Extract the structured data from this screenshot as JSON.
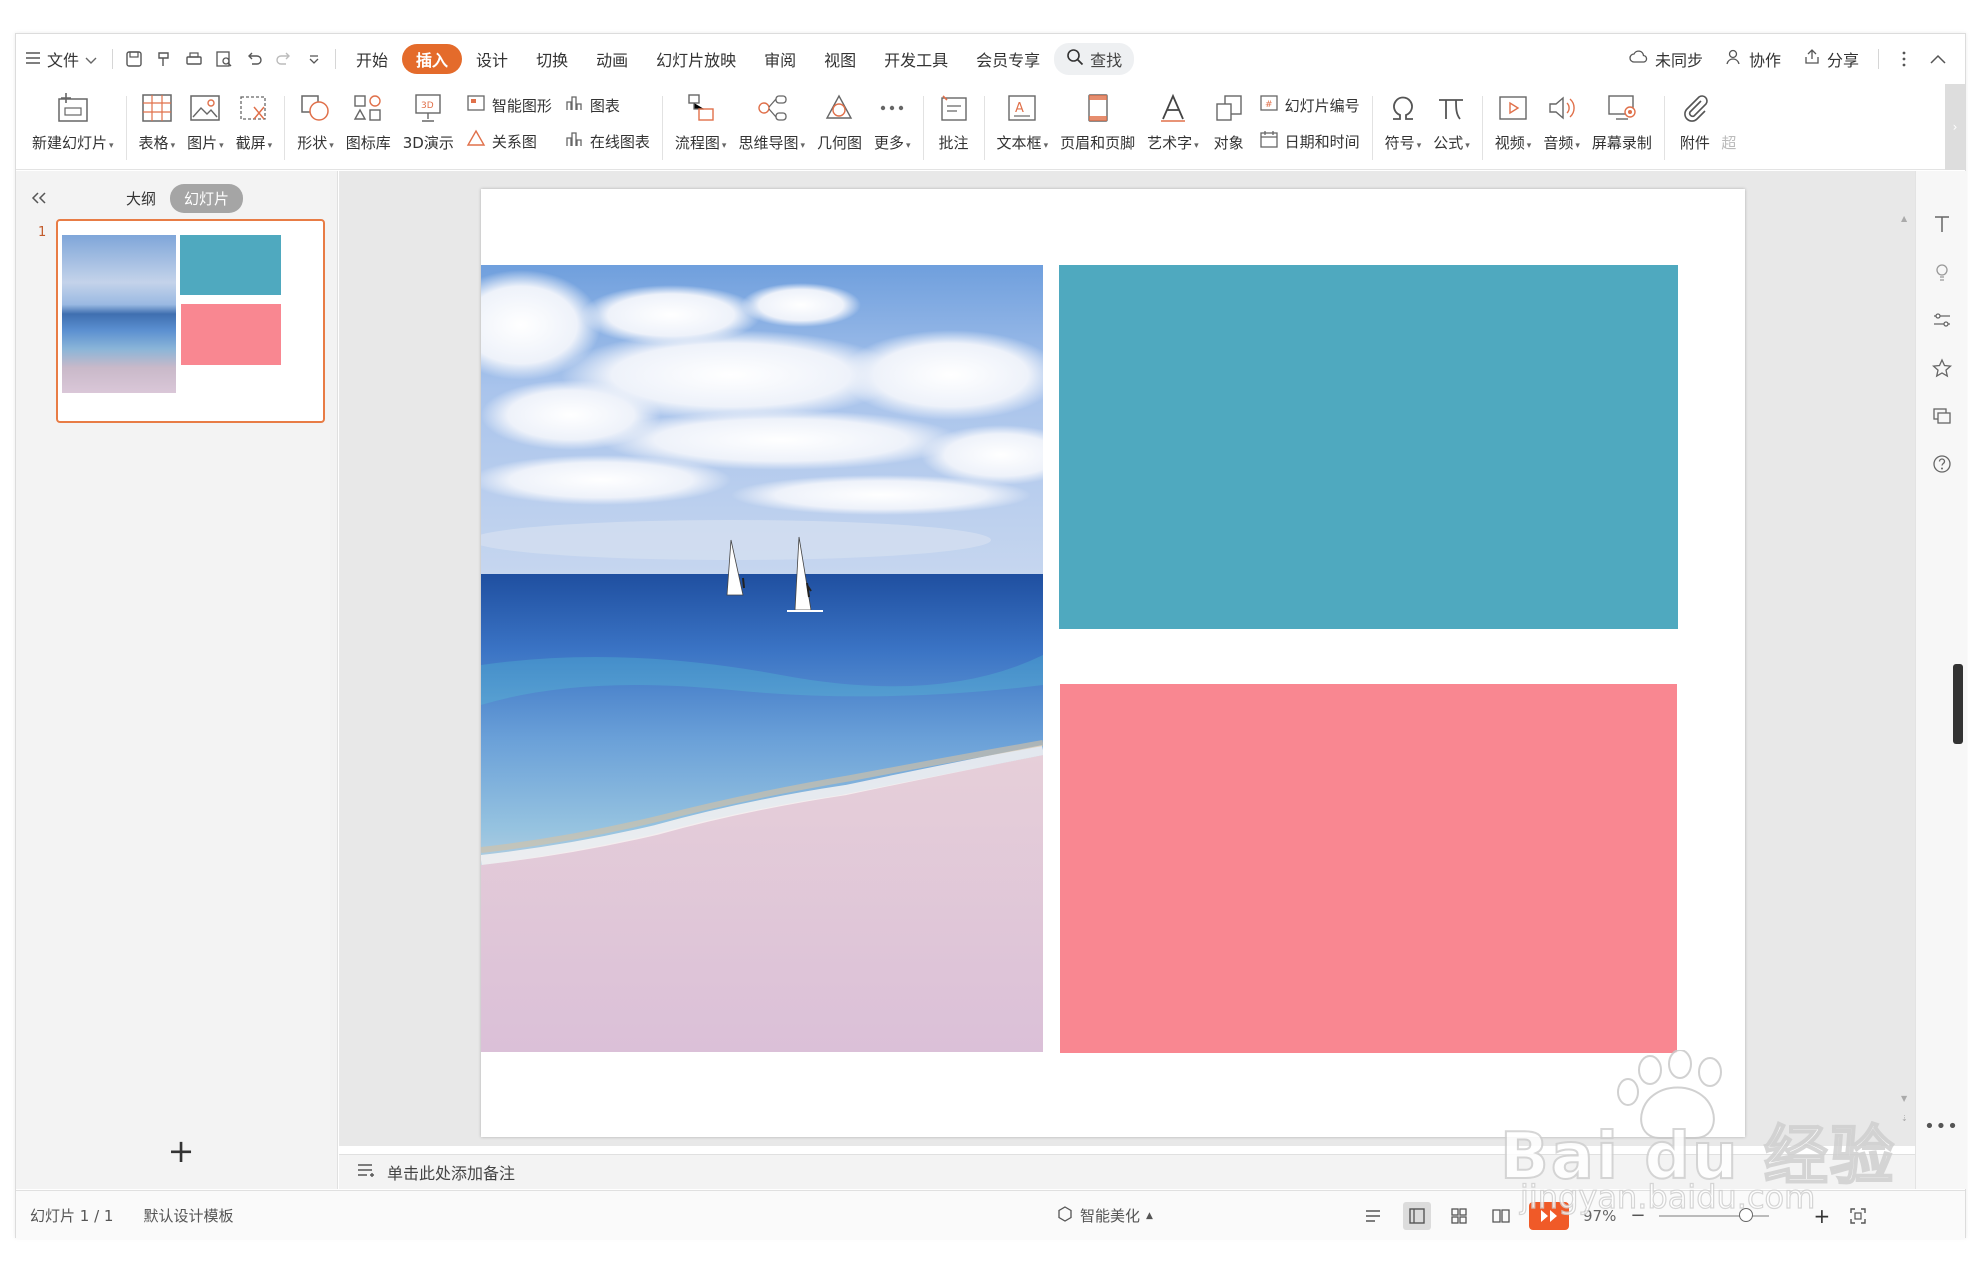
{
  "menubar": {
    "menu_button": "文件",
    "tabs": [
      "开始",
      "插入",
      "设计",
      "切换",
      "动画",
      "幻灯片放映",
      "审阅",
      "视图",
      "开发工具",
      "会员专享"
    ],
    "active_tab": "插入",
    "search": "查找",
    "right": {
      "sync": "未同步",
      "collab": "协作",
      "share": "分享"
    }
  },
  "ribbon": {
    "new_slide": "新建幻灯片",
    "table": "表格",
    "picture": "图片",
    "screenshot": "截屏",
    "shape": "形状",
    "icon_lib": "图标库",
    "demo3d": "3D演示",
    "smart_graphic": "智能图形",
    "relation": "关系图",
    "chart": "图表",
    "online_chart": "在线图表",
    "flowchart": "流程图",
    "mindmap": "思维导图",
    "geometry": "几何图",
    "more": "更多",
    "comment": "批注",
    "textbox": "文本框",
    "header_footer": "页眉和页脚",
    "wordart": "艺术字",
    "object": "对象",
    "slide_number": "幻灯片编号",
    "datetime": "日期和时间",
    "symbol": "符号",
    "formula": "公式",
    "video": "视频",
    "audio": "音频",
    "screen_record": "屏幕录制",
    "attachment": "附件",
    "overflow": "超"
  },
  "left_panel": {
    "outline_tab": "大纲",
    "slides_tab": "幻灯片",
    "slide_index": "1"
  },
  "slide": {
    "teal_color": "#4fa9bf",
    "pink_color": "#f98791"
  },
  "notes": {
    "placeholder": "单击此处添加备注"
  },
  "status": {
    "slide_count": "幻灯片 1 / 1",
    "template": "默认设计模板",
    "beautify": "智能美化",
    "zoom": "97%"
  },
  "watermark": {
    "brand": "Bai du 经验",
    "url": "jingyan.baidu.com"
  }
}
